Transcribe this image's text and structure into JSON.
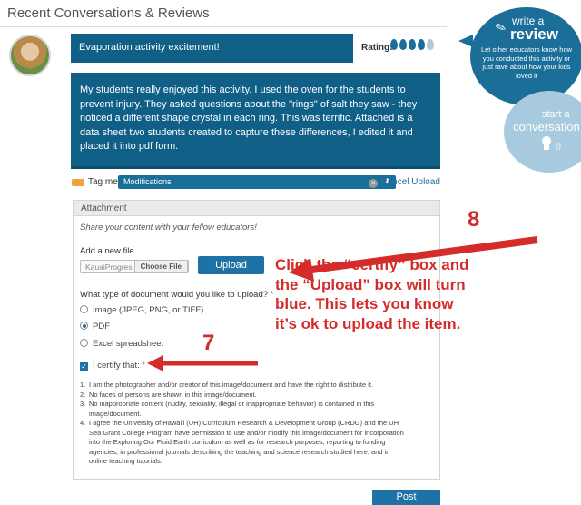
{
  "page": {
    "section_title": "Recent Conversations & Reviews"
  },
  "post": {
    "subject": "Evaporation activity excitement!",
    "rating_label": "Rating:",
    "rating_value": 4,
    "rating_max": 5,
    "body": "My students really enjoyed this activity. I used the oven for the students to prevent injury. They asked questions about the \"rings\" of salt they saw - they noticed a different shape crystal in each ring. This was terrific. Attached is a data sheet two students created to capture these differences, I edited it and placed it into pdf form."
  },
  "tag_row": {
    "tag_label": "Tag me",
    "selected_tag": "Modifications",
    "cancel_upload": "Cancel Upload"
  },
  "attachment": {
    "header": "Attachment",
    "share_text": "Share your content with your fellow educators!",
    "add_new_label": "Add a new file",
    "file_name": "KauaiProgres...",
    "choose_file": "Choose File",
    "upload_button": "Upload",
    "doc_type_question": "What type of document would you like to upload?",
    "required_mark": "*",
    "options": [
      {
        "label": "Image (JPEG, PNG, or TIFF)",
        "selected": false
      },
      {
        "label": "PDF",
        "selected": true
      },
      {
        "label": "Excel spreadsheet",
        "selected": false
      }
    ],
    "certify_label": "I certify that:",
    "certify_checked": true,
    "terms": [
      {
        "num": "1.",
        "text": "I am the photographer and/or creator of this image/document and have the right to distribute it."
      },
      {
        "num": "2.",
        "text": "No faces of persons are shown in this image/document."
      },
      {
        "num": "3.",
        "text": "No inappropriate content (nudity, sexuality, illegal or inappropriate behavior) is contained in this image/document."
      },
      {
        "num": "4.",
        "text": "I agree the University of Hawai'i (UH) Curriculum Research & Development Group (CRDG) and the UH Sea Grant College Program have permission to use and/or modify this image/document for incorporation into the Exploring Our Fluid Earth curriculum as well as for research purposes, reporting to funding agencies, in professional journals describing the teaching and science research studied here, and in online teaching tutorials."
      }
    ]
  },
  "post_button": "Post",
  "sidebar": {
    "write_a": "write a",
    "review": "review",
    "review_sub": "Let other educators know how you conducted this activity or just rave about how your kids loved it",
    "start_a": "start a",
    "conversation": "conversation"
  },
  "annotations": {
    "step_8": "8",
    "step_7": "7",
    "instruction": "Click the “certify” box and the “Upload” box will turn blue. This lets you know it’s ok to upload the item."
  },
  "colors": {
    "primary_blue": "#0f5f86",
    "button_blue": "#1f72a5",
    "annotation_red": "#d42b2b",
    "tag_orange": "#f0a23b",
    "conversation_bubble": "#a7cadf"
  }
}
